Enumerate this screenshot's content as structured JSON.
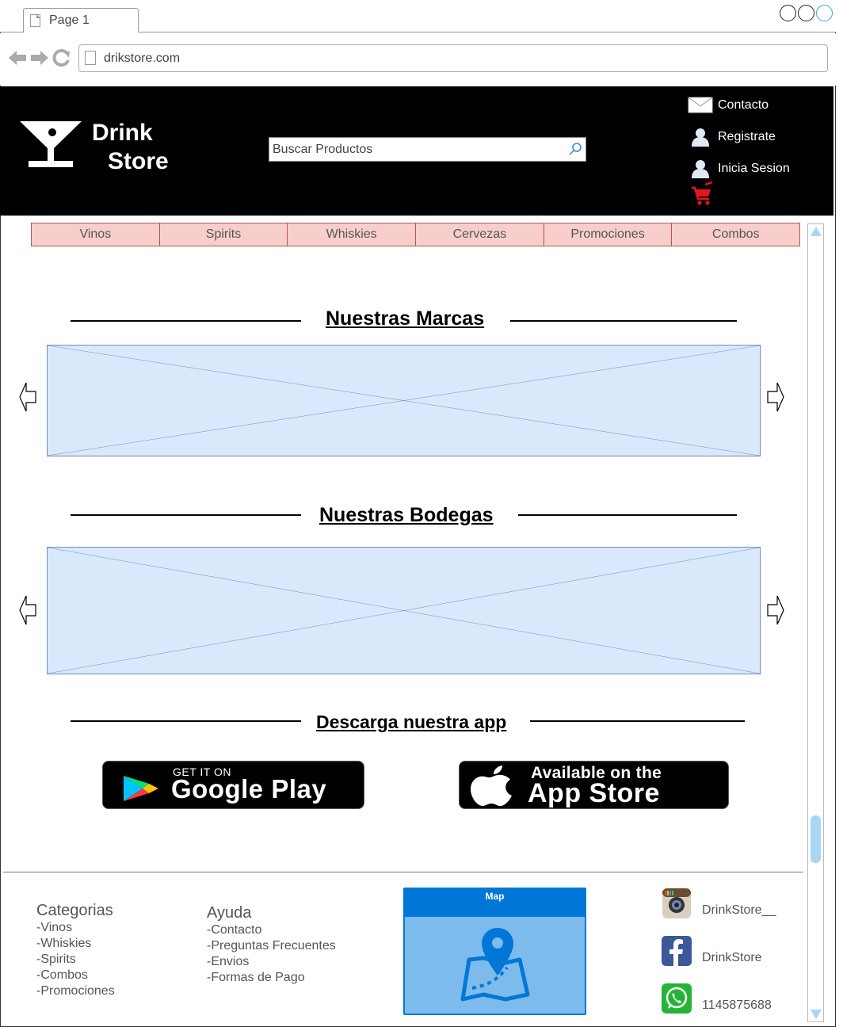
{
  "browser": {
    "tab_title": "Page 1",
    "url": "drikstore.com"
  },
  "header": {
    "brand_line1": "Drink",
    "brand_line2": "Store",
    "search_placeholder": "Buscar Productos",
    "links": {
      "contacto": "Contacto",
      "registrate": "Registrate",
      "inicia_sesion": "Inicia Sesion"
    }
  },
  "categories_nav": [
    "Vinos",
    "Spirits",
    "Whiskies",
    "Cervezas",
    "Promociones",
    "Combos"
  ],
  "sections": {
    "marcas_title": "Nuestras Marcas",
    "bodegas_title": "Nuestras Bodegas",
    "app_title": "Descarga nuestra app"
  },
  "badges": {
    "google_small": "GET IT ON",
    "google_big": "Google Play",
    "apple_small": "Available on the",
    "apple_big": "App Store"
  },
  "footer": {
    "categorias": {
      "title": "Categorias",
      "items": [
        "-Vinos",
        "-Whiskies",
        "-Spirits",
        "-Combos",
        "-Promociones"
      ]
    },
    "ayuda": {
      "title": "Ayuda",
      "items": [
        "-Contacto",
        "-Preguntas Frecuentes",
        "-Envios",
        "-Formas de Pago"
      ]
    },
    "map_title": "Map",
    "social": {
      "instagram": "DrinkStore__",
      "facebook": "DrinkStore",
      "whatsapp": "1145875688"
    }
  },
  "colors": {
    "header_bg": "#000000",
    "nav_fill": "#f8cecc",
    "nav_border": "#b85450",
    "placeholder_fill": "#dae8fc",
    "placeholder_border": "#6c8ebf",
    "map_blue": "#0077d6",
    "cart_red": "#e8141c"
  }
}
